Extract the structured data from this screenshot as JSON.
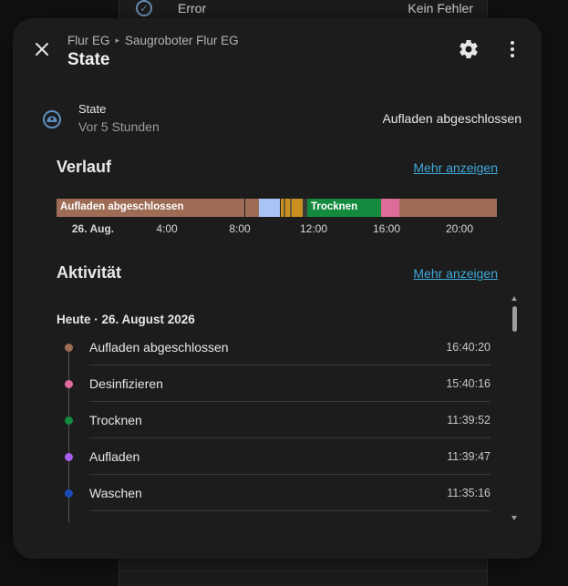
{
  "background": {
    "row_label": "Error",
    "row_value": "Kein Fehler"
  },
  "dialog": {
    "breadcrumb": [
      "Flur EG",
      "Saugroboter Flur EG"
    ],
    "title": "State"
  },
  "state": {
    "name": "State",
    "last_changed": "Vor 5 Stunden",
    "value": "Aufladen abgeschlossen"
  },
  "history": {
    "title": "Verlauf",
    "more_label": "Mehr anzeigen",
    "segments": [
      {
        "label": "Aufladen abgeschlossen",
        "color": "#9e6b54"
      },
      {
        "label": "",
        "color": "#9e6b54"
      },
      {
        "label": "",
        "color": "#a7c4f5"
      },
      {
        "label": "",
        "color": "#c8901f"
      },
      {
        "label": "",
        "color": "#6a5a37"
      },
      {
        "label": "",
        "color": "#c8901f"
      },
      {
        "label": "",
        "color": "#6a5a37"
      },
      {
        "label": "",
        "color": "#c8901f"
      },
      {
        "label": "",
        "color": "#3a3a3a"
      },
      {
        "label": "Trocknen",
        "color": "#138a3d"
      },
      {
        "label": "",
        "color": "#de6b9b"
      },
      {
        "label": "",
        "color": "#9e6b54"
      }
    ],
    "axis_ticks": [
      "26. Aug.",
      "4:00",
      "8:00",
      "12:00",
      "16:00",
      "20:00"
    ]
  },
  "activity": {
    "title": "Aktivität",
    "more_label": "Mehr anzeigen",
    "day": "Heute · 26. August 2026",
    "items": [
      {
        "name": "Aufladen abgeschlossen",
        "time": "16:40:20",
        "color": "#9e6b54"
      },
      {
        "name": "Desinfizieren",
        "time": "15:40:16",
        "color": "#de6b9b"
      },
      {
        "name": "Trocknen",
        "time": "11:39:52",
        "color": "#138a3d"
      },
      {
        "name": "Aufladen",
        "time": "11:39:47",
        "color": "#a65ef0"
      },
      {
        "name": "Waschen",
        "time": "11:35:16",
        "color": "#1c4ab8"
      }
    ]
  }
}
